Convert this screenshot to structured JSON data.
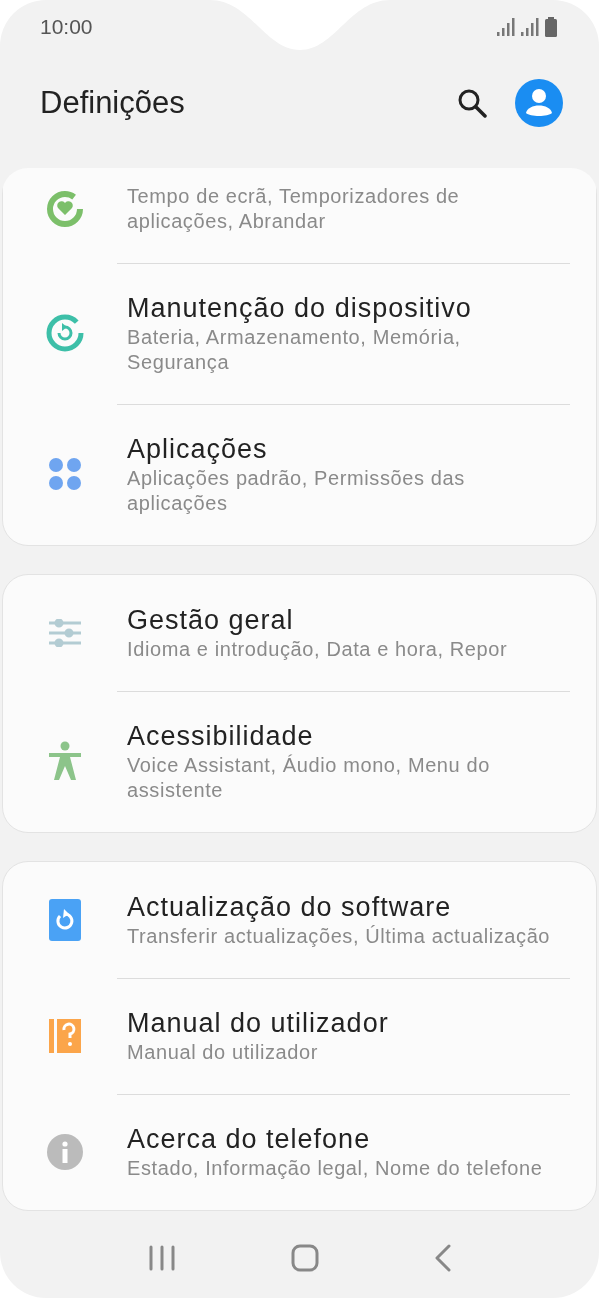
{
  "status_bar": {
    "time": "10:00"
  },
  "header": {
    "title": "Definições"
  },
  "groups": [
    {
      "items": [
        {
          "kind": "wellbeing",
          "subtitle": "Tempo de ecrã, Temporizadores de aplicações, Abrandar"
        },
        {
          "kind": "maintenance",
          "title": "Manutenção do dispositivo",
          "subtitle": "Bateria, Armazenamento, Memória, Segurança"
        },
        {
          "kind": "apps",
          "title": "Aplicações",
          "subtitle": "Aplicações padrão, Permissões das aplicações"
        }
      ]
    },
    {
      "items": [
        {
          "kind": "general",
          "title": "Gestão geral",
          "subtitle": "Idioma e introdução, Data e hora, Repor"
        },
        {
          "kind": "accessibility",
          "title": "Acessibilidade",
          "subtitle": "Voice Assistant, Áudio mono, Menu do assistente"
        }
      ]
    },
    {
      "items": [
        {
          "kind": "update",
          "title": "Actualização do software",
          "subtitle": "Transferir actualizações, Última actualização"
        },
        {
          "kind": "manual",
          "title": "Manual do utilizador",
          "subtitle": "Manual do utilizador"
        },
        {
          "kind": "about",
          "title": "Acerca do telefone",
          "subtitle": "Estado, Informação legal, Nome do telefone"
        }
      ]
    }
  ]
}
